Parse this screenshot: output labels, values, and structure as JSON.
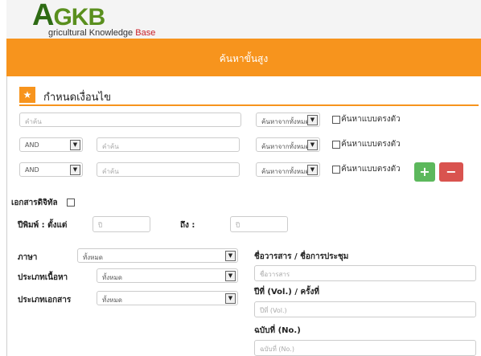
{
  "logo": {
    "main": "GKB",
    "initial": "A",
    "sub_1": "gricultural Knowledge",
    "sub_2": "Base"
  },
  "banner": {
    "title": "ค้นหาขั้นสูง"
  },
  "conditions": {
    "title": "กำหนดเงื่อนไข",
    "rows": [
      {
        "operator": "",
        "placeholder": "คำค้น",
        "scope": "ค้นหาจากทั้งหมด",
        "exact_label": "ค้นหาแบบตรงตัว"
      },
      {
        "operator": "AND",
        "placeholder": "คำค้น",
        "scope": "ค้นหาจากทั้งหมด",
        "exact_label": "ค้นหาแบบตรงตัว"
      },
      {
        "operator": "AND",
        "placeholder": "คำค้น",
        "scope": "ค้นหาจากทั้งหมด",
        "exact_label": "ค้นหาแบบตรงตัว"
      }
    ],
    "add_button": "+",
    "remove_button": "−"
  },
  "digital": {
    "label": "เอกสารดิจิทัล"
  },
  "year": {
    "from_label": "ปีพิมพ์ : ตั้งแต่",
    "from_placeholder": "ปี",
    "to_label": "ถึง :",
    "to_placeholder": "ปี"
  },
  "filters": {
    "language_label": "ภาษา",
    "language_value": "ทั้งหมด",
    "content_type_label": "ประเภทเนื้อหา",
    "content_type_value": "ทั้งหมด",
    "doc_type_label": "ประเภทเอกสาร",
    "doc_type_value": "ทั้งหมด"
  },
  "journal": {
    "name_label": "ชื่อวารสาร / ชื่อการประชุม",
    "name_placeholder": "ชื่อวารสาร",
    "vol_label": "ปีที่ (Vol.) / ครั้งที่",
    "vol_placeholder": "ปีที่ (Vol.)",
    "no_label": "ฉบับที่ (No.)",
    "no_placeholder": "ฉบับที่ (No.)"
  },
  "colors": {
    "accent": "#f7941d",
    "green": "#5cb85c",
    "red": "#d9534f",
    "logo_green": "#5a8f1e"
  }
}
